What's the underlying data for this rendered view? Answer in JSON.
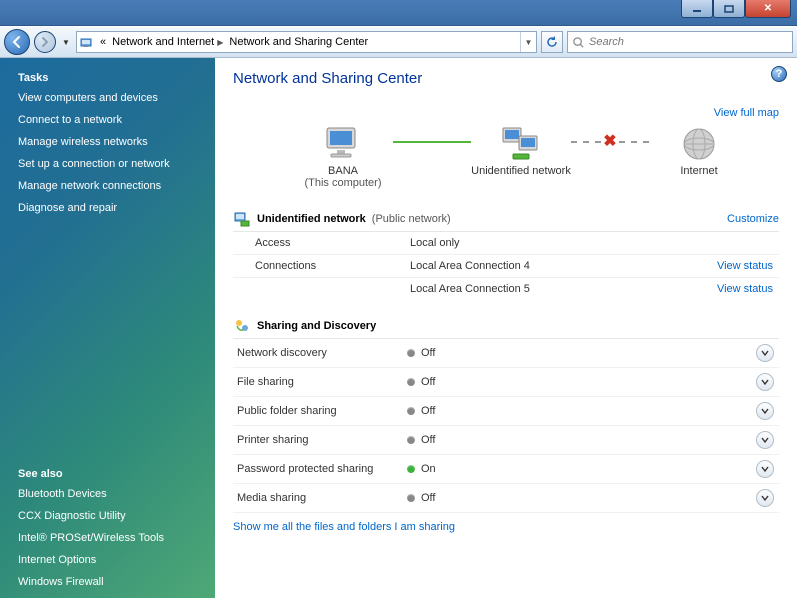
{
  "window": {
    "min": "—",
    "max": "☐",
    "close": "✕"
  },
  "toolbar": {
    "breadcrumb_prefix": "«",
    "crumb1": "Network and Internet",
    "crumb2": "Network and Sharing Center",
    "search_placeholder": "Search"
  },
  "sidebar": {
    "tasks_heading": "Tasks",
    "tasks": [
      "View computers and devices",
      "Connect to a network",
      "Manage wireless networks",
      "Set up a connection or network",
      "Manage network connections",
      "Diagnose and repair"
    ],
    "seealso_heading": "See also",
    "seealso": [
      "Bluetooth Devices",
      "CCX Diagnostic Utility",
      "Intel® PROSet/Wireless Tools",
      "Internet Options",
      "Windows Firewall"
    ]
  },
  "page": {
    "title": "Network and Sharing Center",
    "view_full_map": "View full map",
    "map": {
      "node1_label": "BANA",
      "node1_sub": "(This computer)",
      "node2_label": "Unidentified network",
      "node3_label": "Internet"
    },
    "network": {
      "name": "Unidentified network",
      "type_label": "(Public network)",
      "customize": "Customize",
      "rows": [
        {
          "label": "Access",
          "value": "Local only",
          "action": ""
        },
        {
          "label": "Connections",
          "value": "Local Area Connection 4",
          "action": "View status"
        },
        {
          "label": "",
          "value": "Local Area Connection 5",
          "action": "View status"
        }
      ]
    },
    "sharing": {
      "heading": "Sharing and Discovery",
      "rows": [
        {
          "label": "Network discovery",
          "status": "Off",
          "on": false
        },
        {
          "label": "File sharing",
          "status": "Off",
          "on": false
        },
        {
          "label": "Public folder sharing",
          "status": "Off",
          "on": false
        },
        {
          "label": "Printer sharing",
          "status": "Off",
          "on": false
        },
        {
          "label": "Password protected sharing",
          "status": "On",
          "on": true
        },
        {
          "label": "Media sharing",
          "status": "Off",
          "on": false
        }
      ]
    },
    "bottom_link": "Show me all the files and folders I am sharing"
  }
}
